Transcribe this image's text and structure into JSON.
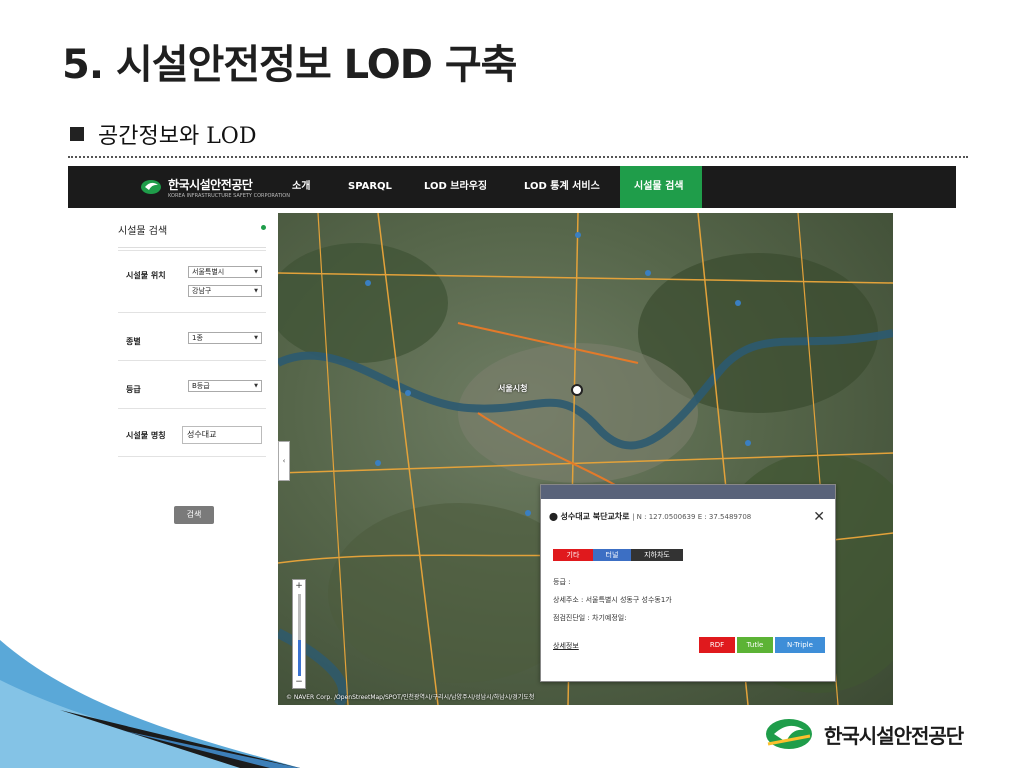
{
  "slide": {
    "title": "5. 시설안전정보 LOD 구축",
    "bullet": "공간정보와 LOD"
  },
  "nav": {
    "logo_text": "한국시설안전공단",
    "logo_sub": "KOREA INFRASTRUCTURE SAFETY CORPORATION",
    "items": [
      "소개",
      "SPARQL",
      "LOD 브라우징",
      "LOD 통계 서비스",
      "시설물 검색"
    ],
    "active_index": 4,
    "active_color": "#1f9d4a"
  },
  "sidebar": {
    "header": "시설물 검색",
    "location_label": "시설물 위치",
    "city_value": "서울특별시",
    "district_value": "강남구",
    "type_label": "종별",
    "type_value": "1종",
    "grade_label": "등급",
    "grade_value": "B등급",
    "name_label": "시설물 명칭",
    "name_value": "성수대교",
    "search_button": "검색"
  },
  "map": {
    "copyright": "© NAVER Corp. /OpenStreetMap/SPOT/인천광역시/구리시/남양주시/성남시/하남시/경기도청",
    "labels": {
      "city_hall": "서울시청"
    }
  },
  "popup": {
    "title": "성수대교 북단교차로",
    "coordinates": "| N : 127.0500639 E : 37.5489708",
    "tags": [
      "기타",
      "터널",
      "지하차도"
    ],
    "grade": "등급 :",
    "address": "상세주소 : 서울특별시 성동구 성수동1가",
    "inspection": "점검진단일 : 차기예정일:",
    "detail_link": "상세정보",
    "buttons": [
      "RDF",
      "Tutle",
      "N-Triple"
    ]
  },
  "footer_logo": "한국시설안전공단",
  "colors": {
    "brand_green": "#1f9d4a",
    "nav_bg": "#1b1b1b",
    "rdf": "#e0191d",
    "turtle": "#5cb335",
    "ntriple": "#3e8ed8",
    "accent_blue": "#2a7fd4"
  }
}
